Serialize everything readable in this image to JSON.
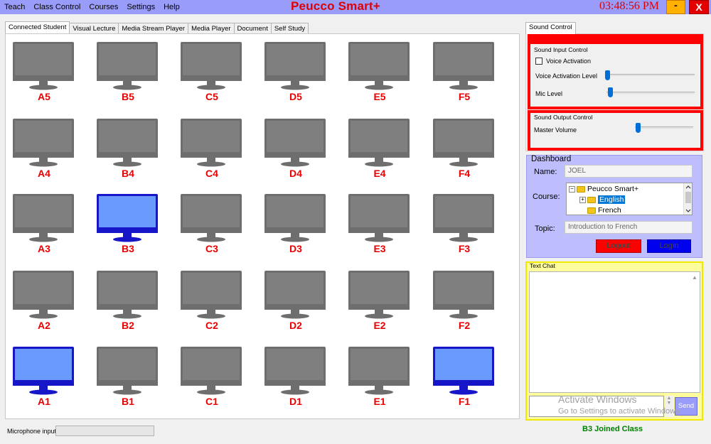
{
  "menu": [
    "Teach",
    "Class Control",
    "Courses",
    "Settings",
    "Help"
  ],
  "app_title": "Peucco Smart+",
  "clock": "03:48:56 PM",
  "window_controls": {
    "minimize": "-",
    "close": "X"
  },
  "tabs": [
    "Connected Student",
    "Visual Lecture",
    "Media Stream Player",
    "Media Player",
    "Document",
    "Self Study"
  ],
  "active_tab": "Connected Student",
  "stations": [
    [
      "A5",
      "B5",
      "C5",
      "D5",
      "E5",
      "F5"
    ],
    [
      "A4",
      "B4",
      "C4",
      "D4",
      "E4",
      "F4"
    ],
    [
      "A3",
      "B3",
      "C3",
      "D3",
      "E3",
      "F3"
    ],
    [
      "A2",
      "B2",
      "C2",
      "D2",
      "E2",
      "F2"
    ],
    [
      "A1",
      "B1",
      "C1",
      "D1",
      "E1",
      "F1"
    ]
  ],
  "active_stations": [
    "B3",
    "A1",
    "F1"
  ],
  "colors": {
    "inactive_screen": "#7f7f7f",
    "inactive_frame": "#6e6e6e",
    "active_screen": "#6a9afe",
    "active_frame": "#1616c8",
    "station_label": "#e80000"
  },
  "status_bar": {
    "mic_label": "Microphone input"
  },
  "sound_control": {
    "tab": "Sound Control",
    "input_title": "Sound Input Control",
    "voice_activation": "Voice Activation",
    "voice_activation_level": "Voice Activation Level",
    "mic_level": "Mic Level",
    "output_title": "Sound Output Control",
    "master_volume": "Master Volume"
  },
  "dashboard": {
    "title": "Dashboard",
    "name_label": "Name:",
    "name_value": "JOEL",
    "course_label": "Course:",
    "tree_root": "Peucco Smart+",
    "tree_selected": "English",
    "tree_child": "French",
    "topic_label": "Topic:",
    "topic_value": "Introduction to French",
    "logout": "Logout",
    "login": "Login"
  },
  "chat": {
    "title": "Text Chat",
    "send": "Send"
  },
  "watermark": {
    "line1": "Activate Windows",
    "line2": "Go to Settings to activate Windows."
  },
  "status_message": "B3 Joined Class"
}
